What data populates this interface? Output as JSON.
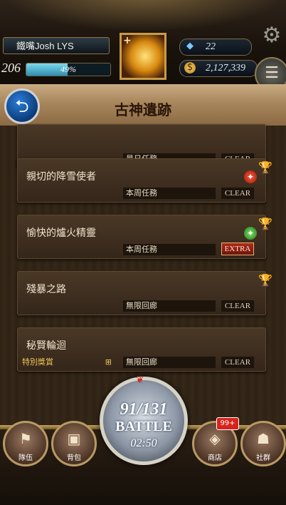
{
  "header": {
    "player_name": "鐵嘴Josh LYS",
    "level": "206",
    "exp_percent": "49%",
    "exp_fraction": 0.49,
    "gems": "22",
    "gold": "2,127,339",
    "icons": {
      "avatar": "fire-spirit-icon",
      "gem": "crystal-icon",
      "gold": "coin-icon",
      "settings": "gear-icon",
      "menu": "menu-icon"
    }
  },
  "page": {
    "title": "古神遺跡",
    "back_icon": "back-arrow-icon"
  },
  "quests": [
    {
      "title": "",
      "gold_tag": "",
      "sub": "是日任務",
      "action": "CLEAR",
      "status": "",
      "trophy": false
    },
    {
      "title": "親切的降雪使者",
      "gold_tag": "",
      "sub": "本周任務",
      "action": "CLEAR",
      "status": "red",
      "trophy": true
    },
    {
      "title": "愉快的爐火精靈",
      "gold_tag": "",
      "sub": "本周任務",
      "action": "EXTRA",
      "status": "green",
      "trophy": true
    },
    {
      "title": "殘暴之路",
      "gold_tag": "",
      "sub": "無限回廊",
      "action": "CLEAR",
      "status": "",
      "trophy": true
    },
    {
      "title": "秘賢輪迴",
      "gold_tag": "特別獎賞",
      "sub": "無限回廊",
      "action": "CLEAR",
      "status": "",
      "trophy": false
    }
  ],
  "battle": {
    "count": "91/131",
    "label": "BATTLE",
    "timer": "02:50"
  },
  "nav": {
    "items": [
      {
        "label": "隊伍",
        "icon": "banner-icon"
      },
      {
        "label": "背包",
        "icon": "chest-icon"
      },
      {
        "label": "商店",
        "icon": "treasure-icon"
      },
      {
        "label": "社群",
        "icon": "community-icon"
      }
    ],
    "shop_badge": "99+"
  }
}
